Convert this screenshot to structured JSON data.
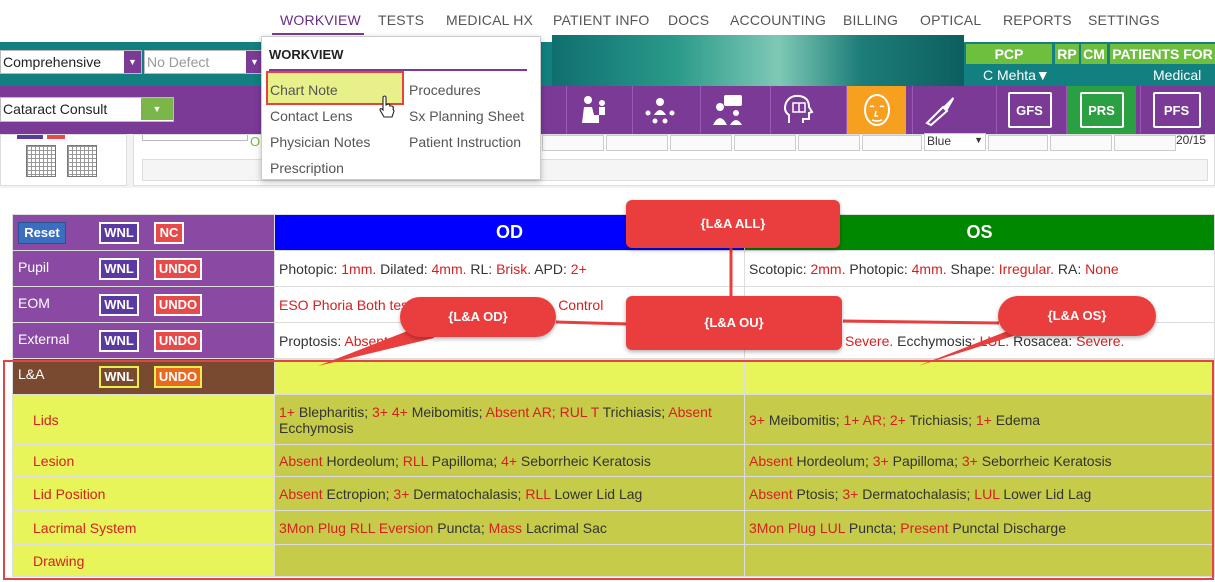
{
  "nav": {
    "items": [
      "WORKVIEW",
      "TESTS",
      "MEDICAL HX",
      "PATIENT INFO",
      "DOCS",
      "ACCOUNTING",
      "BILLING",
      "OPTICAL",
      "REPORTS",
      "SETTINGS"
    ],
    "active": "WORKVIEW"
  },
  "selectors": {
    "exam_type": "Comprehensive",
    "defect": "No Defect",
    "visit_template": "Cataract Consult"
  },
  "right_panel": {
    "pcp": "PCP",
    "rp": "RP",
    "cm": "CM",
    "patients_for": "PATIENTS FOR",
    "doctor": "C Mehta▼",
    "medical": "Medical"
  },
  "toolbar_boxes": {
    "gfs": "GFS",
    "prs": "PRS",
    "pfs": "PFS"
  },
  "sub_area": {
    "os_label": "OS",
    "color_value": "Blue",
    "acuity": "20/15"
  },
  "menu": {
    "title": "WORKVIEW",
    "left": [
      "Chart Note",
      "Contact Lens",
      "Physician Notes",
      "Prescription"
    ],
    "right": [
      "Procedures",
      "Sx Planning Sheet",
      "Patient Instruction"
    ],
    "highlighted": "Chart Note"
  },
  "exam": {
    "buttons": {
      "reset": "Reset",
      "wnl": "WNL",
      "nc": "NC",
      "undo": "UNDO"
    },
    "header": {
      "od": "OD",
      "os": "OS"
    },
    "rows": {
      "pupil": {
        "label": "Pupil"
      },
      "eom": {
        "label": "EOM",
        "od": "ESO Phoria Both tes",
        "od_tail": "Control"
      },
      "external": {
        "label": "External"
      },
      "la": {
        "label": "L&A"
      }
    },
    "la_rows": [
      "Lids",
      "Lesion",
      "Lid Position",
      "Lacrimal System",
      "Drawing"
    ]
  },
  "callouts": {
    "all": "{L&A ALL}",
    "od": "{L&A OD}",
    "ou": "{L&A OU}",
    "os": "{L&A OS}"
  },
  "colors": {
    "purple": "#7a3a96",
    "teal": "#128080",
    "green": "#6fbf3f",
    "red": "#ea3e3e",
    "od_blue": "#0000ff",
    "os_green": "#008800",
    "la_yellow": "#e8f55a",
    "la_olive": "#c6cc4a"
  }
}
